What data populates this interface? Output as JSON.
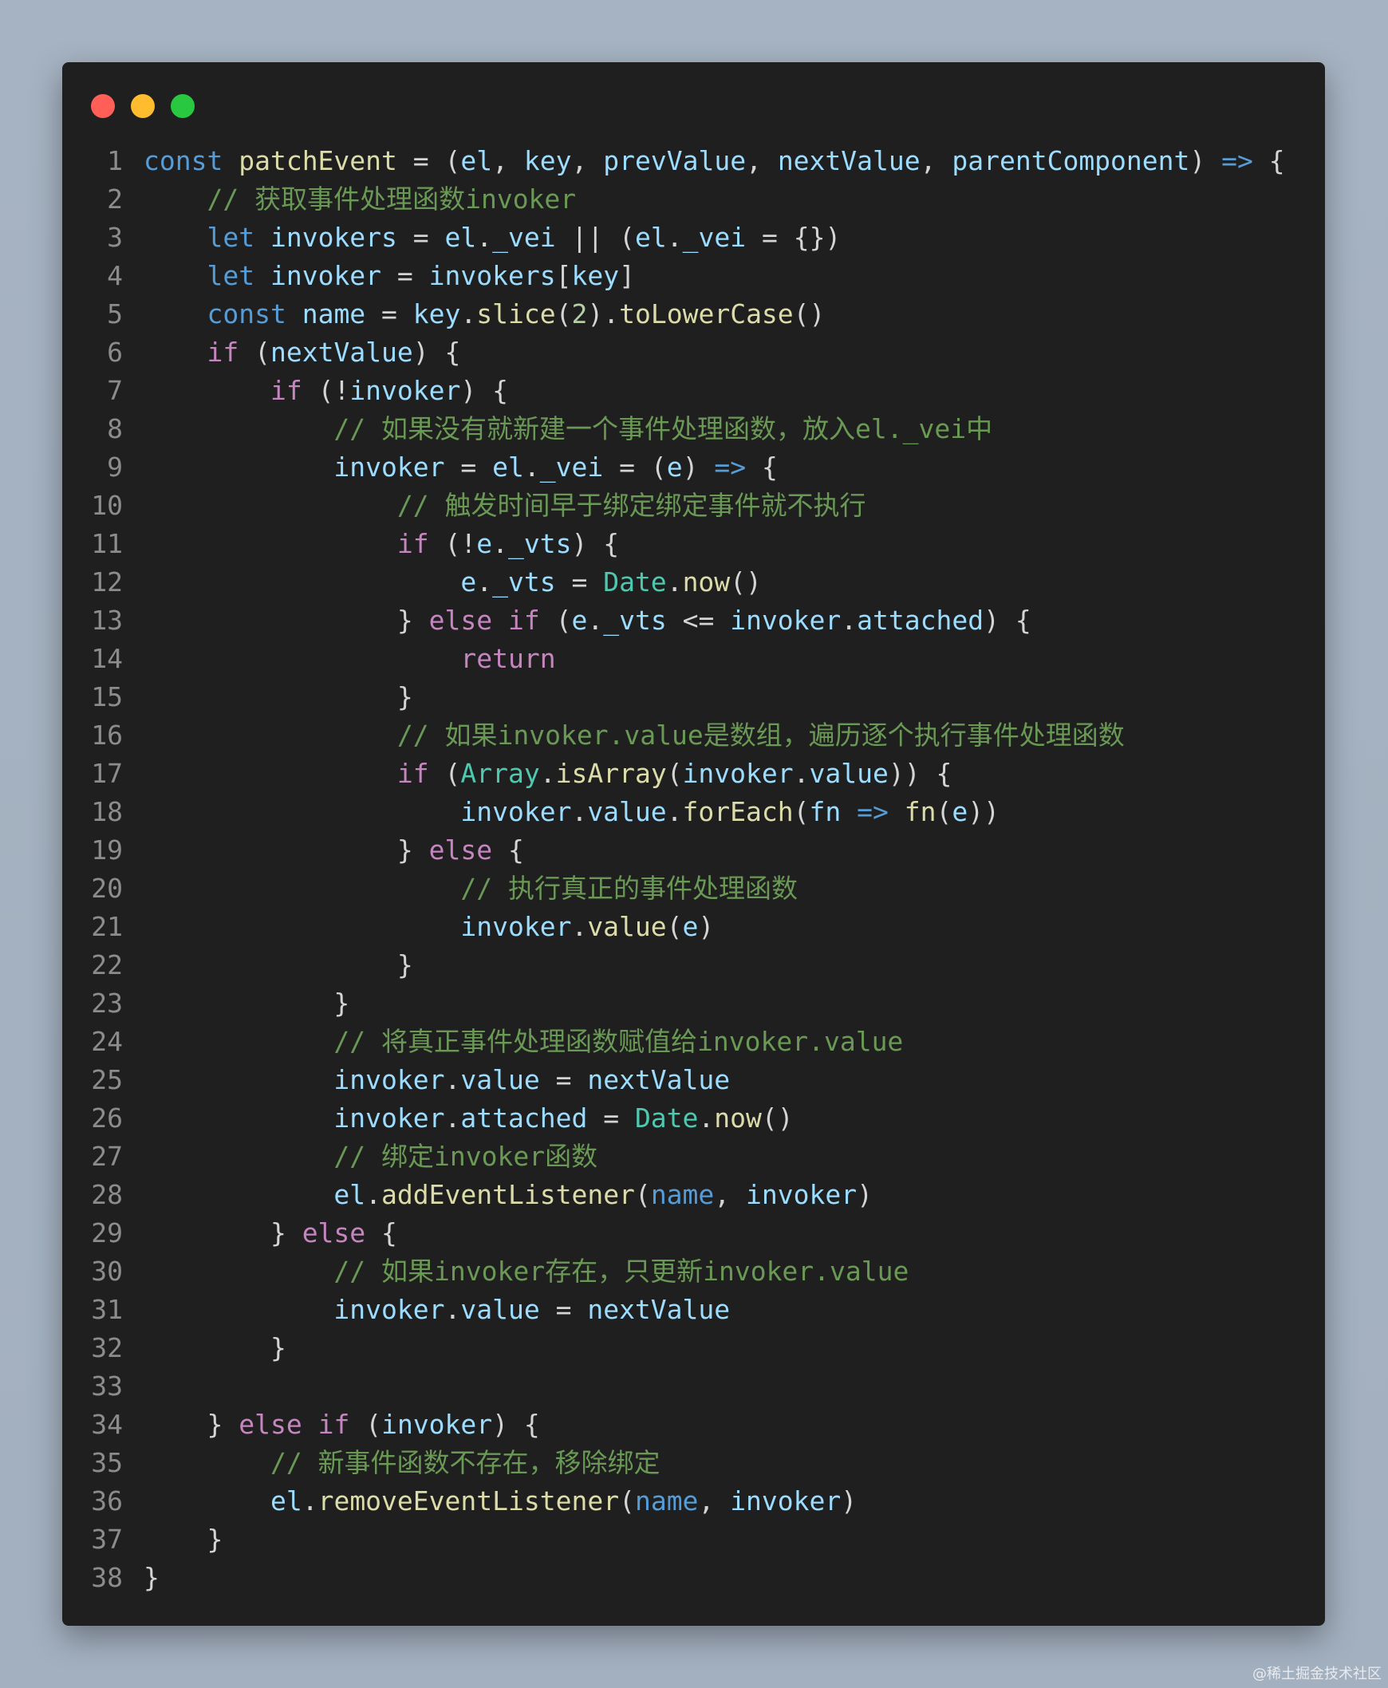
{
  "window": {
    "traffic_lights": [
      {
        "name": "close",
        "color": "#ff5f57"
      },
      {
        "name": "minimize",
        "color": "#febc2e"
      },
      {
        "name": "zoom",
        "color": "#28c840"
      }
    ]
  },
  "code": {
    "line_numbers": [
      "1",
      "2",
      "3",
      "4",
      "5",
      "6",
      "7",
      "8",
      "9",
      "10",
      "11",
      "12",
      "13",
      "14",
      "15",
      "16",
      "17",
      "18",
      "19",
      "20",
      "21",
      "22",
      "23",
      "24",
      "25",
      "26",
      "27",
      "28",
      "29",
      "30",
      "31",
      "32",
      "33",
      "34",
      "35",
      "36",
      "37",
      "38"
    ],
    "lines": [
      [
        [
          "k",
          "const"
        ],
        [
          "p",
          " "
        ],
        [
          "f",
          "patchEvent"
        ],
        [
          "p",
          " = ("
        ],
        [
          "v",
          "el"
        ],
        [
          "p",
          ", "
        ],
        [
          "v",
          "key"
        ],
        [
          "p",
          ", "
        ],
        [
          "v",
          "prevValue"
        ],
        [
          "p",
          ", "
        ],
        [
          "v",
          "nextValue"
        ],
        [
          "p",
          ", "
        ],
        [
          "v",
          "parentComponent"
        ],
        [
          "p",
          ") "
        ],
        [
          "k",
          "=>"
        ],
        [
          "p",
          " {"
        ]
      ],
      [
        [
          "p",
          "    "
        ],
        [
          "cm",
          "// 获取事件处理函数invoker"
        ]
      ],
      [
        [
          "p",
          "    "
        ],
        [
          "k",
          "let"
        ],
        [
          "p",
          " "
        ],
        [
          "v",
          "invokers"
        ],
        [
          "p",
          " = "
        ],
        [
          "v",
          "el"
        ],
        [
          "p",
          "."
        ],
        [
          "v",
          "_vei"
        ],
        [
          "p",
          " || ("
        ],
        [
          "v",
          "el"
        ],
        [
          "p",
          "."
        ],
        [
          "v",
          "_vei"
        ],
        [
          "p",
          " = {})"
        ]
      ],
      [
        [
          "p",
          "    "
        ],
        [
          "k",
          "let"
        ],
        [
          "p",
          " "
        ],
        [
          "v",
          "invoker"
        ],
        [
          "p",
          " = "
        ],
        [
          "v",
          "invokers"
        ],
        [
          "p",
          "["
        ],
        [
          "v",
          "key"
        ],
        [
          "p",
          "]"
        ]
      ],
      [
        [
          "p",
          "    "
        ],
        [
          "k",
          "const"
        ],
        [
          "p",
          " "
        ],
        [
          "v",
          "name"
        ],
        [
          "p",
          " = "
        ],
        [
          "v",
          "key"
        ],
        [
          "p",
          "."
        ],
        [
          "f",
          "slice"
        ],
        [
          "p",
          "("
        ],
        [
          "n",
          "2"
        ],
        [
          "p",
          ")."
        ],
        [
          "f",
          "toLowerCase"
        ],
        [
          "p",
          "()"
        ]
      ],
      [
        [
          "p",
          "    "
        ],
        [
          "c",
          "if"
        ],
        [
          "p",
          " ("
        ],
        [
          "v",
          "nextValue"
        ],
        [
          "p",
          ") {"
        ]
      ],
      [
        [
          "p",
          "        "
        ],
        [
          "c",
          "if"
        ],
        [
          "p",
          " (!"
        ],
        [
          "v",
          "invoker"
        ],
        [
          "p",
          ") {"
        ]
      ],
      [
        [
          "p",
          "            "
        ],
        [
          "cm",
          "// 如果没有就新建一个事件处理函数，放入el._vei中"
        ]
      ],
      [
        [
          "p",
          "            "
        ],
        [
          "v",
          "invoker"
        ],
        [
          "p",
          " = "
        ],
        [
          "v",
          "el"
        ],
        [
          "p",
          "."
        ],
        [
          "v",
          "_vei"
        ],
        [
          "p",
          " = ("
        ],
        [
          "v",
          "e"
        ],
        [
          "p",
          ") "
        ],
        [
          "k",
          "=>"
        ],
        [
          "p",
          " {"
        ]
      ],
      [
        [
          "p",
          "                "
        ],
        [
          "cm",
          "// 触发时间早于绑定绑定事件就不执行"
        ]
      ],
      [
        [
          "p",
          "                "
        ],
        [
          "c",
          "if"
        ],
        [
          "p",
          " (!"
        ],
        [
          "v",
          "e"
        ],
        [
          "p",
          "."
        ],
        [
          "v",
          "_vts"
        ],
        [
          "p",
          ") {"
        ]
      ],
      [
        [
          "p",
          "                    "
        ],
        [
          "v",
          "e"
        ],
        [
          "p",
          "."
        ],
        [
          "v",
          "_vts"
        ],
        [
          "p",
          " = "
        ],
        [
          "t",
          "Date"
        ],
        [
          "p",
          "."
        ],
        [
          "f",
          "now"
        ],
        [
          "p",
          "()"
        ]
      ],
      [
        [
          "p",
          "                } "
        ],
        [
          "c",
          "else"
        ],
        [
          "p",
          " "
        ],
        [
          "c",
          "if"
        ],
        [
          "p",
          " ("
        ],
        [
          "v",
          "e"
        ],
        [
          "p",
          "."
        ],
        [
          "v",
          "_vts"
        ],
        [
          "p",
          " <= "
        ],
        [
          "v",
          "invoker"
        ],
        [
          "p",
          "."
        ],
        [
          "v",
          "attached"
        ],
        [
          "p",
          ") {"
        ]
      ],
      [
        [
          "p",
          "                    "
        ],
        [
          "c",
          "return"
        ]
      ],
      [
        [
          "p",
          "                }"
        ]
      ],
      [
        [
          "p",
          "                "
        ],
        [
          "cm",
          "// 如果invoker.value是数组，遍历逐个执行事件处理函数"
        ]
      ],
      [
        [
          "p",
          "                "
        ],
        [
          "c",
          "if"
        ],
        [
          "p",
          " ("
        ],
        [
          "t",
          "Array"
        ],
        [
          "p",
          "."
        ],
        [
          "f",
          "isArray"
        ],
        [
          "p",
          "("
        ],
        [
          "v",
          "invoker"
        ],
        [
          "p",
          "."
        ],
        [
          "v",
          "value"
        ],
        [
          "p",
          ")) {"
        ]
      ],
      [
        [
          "p",
          "                    "
        ],
        [
          "v",
          "invoker"
        ],
        [
          "p",
          "."
        ],
        [
          "v",
          "value"
        ],
        [
          "p",
          "."
        ],
        [
          "f",
          "forEach"
        ],
        [
          "p",
          "("
        ],
        [
          "v",
          "fn"
        ],
        [
          "p",
          " "
        ],
        [
          "k",
          "=>"
        ],
        [
          "p",
          " "
        ],
        [
          "f",
          "fn"
        ],
        [
          "p",
          "("
        ],
        [
          "v",
          "e"
        ],
        [
          "p",
          "))"
        ]
      ],
      [
        [
          "p",
          "                } "
        ],
        [
          "c",
          "else"
        ],
        [
          "p",
          " {"
        ]
      ],
      [
        [
          "p",
          "                    "
        ],
        [
          "cm",
          "// 执行真正的事件处理函数"
        ]
      ],
      [
        [
          "p",
          "                    "
        ],
        [
          "v",
          "invoker"
        ],
        [
          "p",
          "."
        ],
        [
          "f",
          "value"
        ],
        [
          "p",
          "("
        ],
        [
          "v",
          "e"
        ],
        [
          "p",
          ")"
        ]
      ],
      [
        [
          "p",
          "                }"
        ]
      ],
      [
        [
          "p",
          "            }"
        ]
      ],
      [
        [
          "p",
          "            "
        ],
        [
          "cm",
          "// 将真正事件处理函数赋值给invoker.value"
        ]
      ],
      [
        [
          "p",
          "            "
        ],
        [
          "v",
          "invoker"
        ],
        [
          "p",
          "."
        ],
        [
          "v",
          "value"
        ],
        [
          "p",
          " = "
        ],
        [
          "v",
          "nextValue"
        ]
      ],
      [
        [
          "p",
          "            "
        ],
        [
          "v",
          "invoker"
        ],
        [
          "p",
          "."
        ],
        [
          "v",
          "attached"
        ],
        [
          "p",
          " = "
        ],
        [
          "t",
          "Date"
        ],
        [
          "p",
          "."
        ],
        [
          "f",
          "now"
        ],
        [
          "p",
          "()"
        ]
      ],
      [
        [
          "p",
          "            "
        ],
        [
          "cm",
          "// 绑定invoker函数"
        ]
      ],
      [
        [
          "p",
          "            "
        ],
        [
          "v",
          "el"
        ],
        [
          "p",
          "."
        ],
        [
          "f",
          "addEventListener"
        ],
        [
          "p",
          "("
        ],
        [
          "k",
          "name"
        ],
        [
          "p",
          ", "
        ],
        [
          "v",
          "invoker"
        ],
        [
          "p",
          ")"
        ]
      ],
      [
        [
          "p",
          "        } "
        ],
        [
          "c",
          "else"
        ],
        [
          "p",
          " {"
        ]
      ],
      [
        [
          "p",
          "            "
        ],
        [
          "cm",
          "// 如果invoker存在，只更新invoker.value"
        ]
      ],
      [
        [
          "p",
          "            "
        ],
        [
          "v",
          "invoker"
        ],
        [
          "p",
          "."
        ],
        [
          "v",
          "value"
        ],
        [
          "p",
          " = "
        ],
        [
          "v",
          "nextValue"
        ]
      ],
      [
        [
          "p",
          "        }"
        ]
      ],
      [
        [
          "p",
          ""
        ]
      ],
      [
        [
          "p",
          "    } "
        ],
        [
          "c",
          "else"
        ],
        [
          "p",
          " "
        ],
        [
          "c",
          "if"
        ],
        [
          "p",
          " ("
        ],
        [
          "v",
          "invoker"
        ],
        [
          "p",
          ") {"
        ]
      ],
      [
        [
          "p",
          "        "
        ],
        [
          "cm",
          "// 新事件函数不存在，移除绑定"
        ]
      ],
      [
        [
          "p",
          "        "
        ],
        [
          "v",
          "el"
        ],
        [
          "p",
          "."
        ],
        [
          "f",
          "removeEventListener"
        ],
        [
          "p",
          "("
        ],
        [
          "k",
          "name"
        ],
        [
          "p",
          ", "
        ],
        [
          "v",
          "invoker"
        ],
        [
          "p",
          ")"
        ]
      ],
      [
        [
          "p",
          "    }"
        ]
      ],
      [
        [
          "p",
          "}"
        ]
      ]
    ]
  },
  "watermark": "@稀土掘金技术社区"
}
